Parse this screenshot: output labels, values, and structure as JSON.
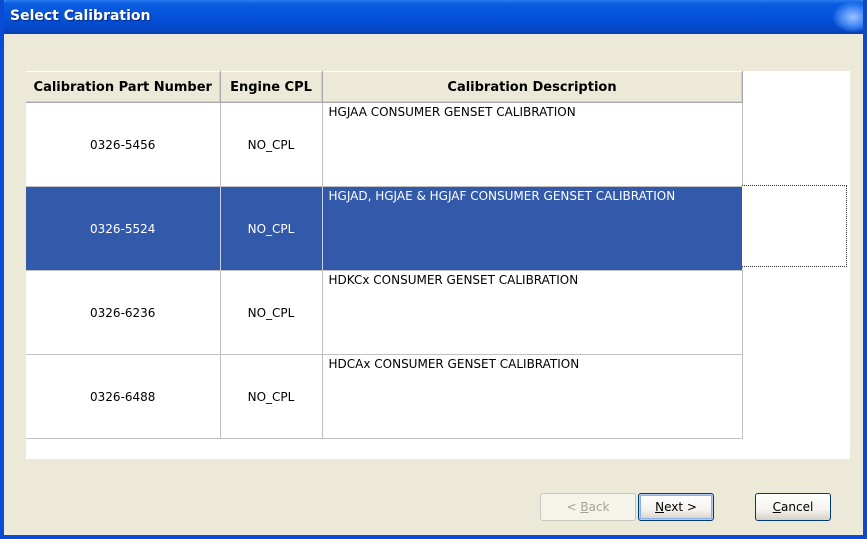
{
  "window": {
    "title": "Select Calibration"
  },
  "grid": {
    "columns": [
      {
        "label": "Calibration Part Number"
      },
      {
        "label": "Engine CPL"
      },
      {
        "label": "Calibration Description"
      }
    ],
    "rows": [
      {
        "part_number": "0326-5456",
        "engine_cpl": "NO_CPL",
        "description": "HGJAA CONSUMER GENSET CALIBRATION",
        "selected": false
      },
      {
        "part_number": "0326-5524",
        "engine_cpl": "NO_CPL",
        "description": "HGJAD, HGJAE & HGJAF CONSUMER GENSET CALIBRATION",
        "selected": true
      },
      {
        "part_number": "0326-6236",
        "engine_cpl": "NO_CPL",
        "description": "HDKCx CONSUMER GENSET CALIBRATION",
        "selected": false
      },
      {
        "part_number": "0326-6488",
        "engine_cpl": "NO_CPL",
        "description": "HDCAx CONSUMER GENSET CALIBRATION",
        "selected": false
      }
    ]
  },
  "buttons": {
    "back_prefix": "< ",
    "back_accel": "B",
    "back_rest": "ack",
    "next_accel": "N",
    "next_rest": "ext >",
    "cancel_accel": "C",
    "cancel_rest": "ancel"
  },
  "colors": {
    "titlebar": "#0551d8",
    "selection": "#3359aa",
    "window_bg": "#ece9d8"
  }
}
